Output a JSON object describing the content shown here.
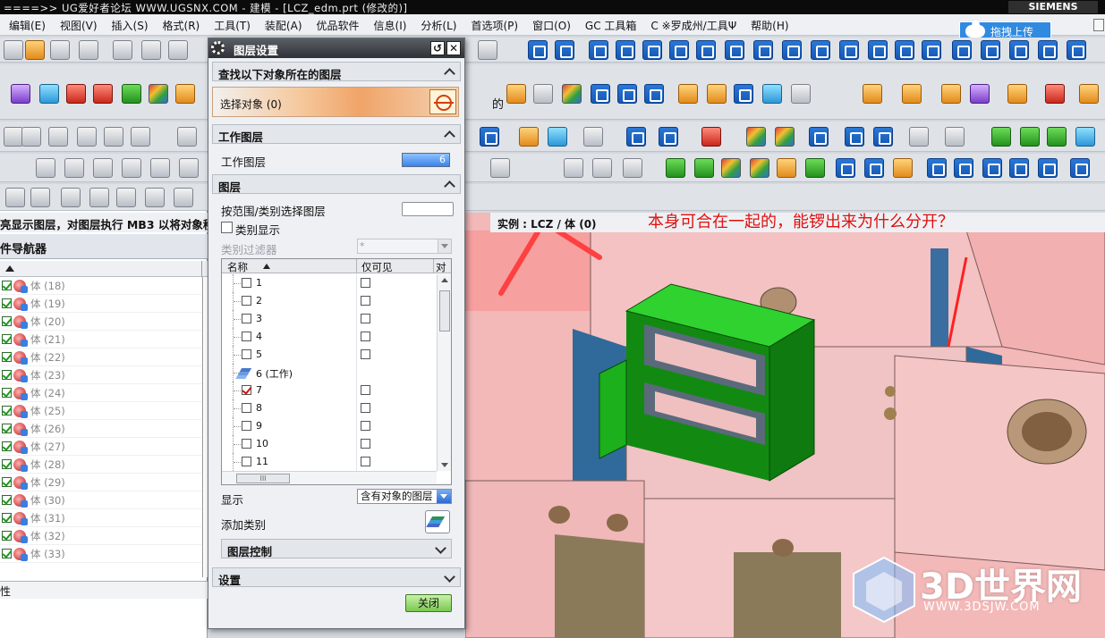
{
  "titlebar": {
    "title": "====>>  UG爱好者论坛  WWW.UGSNX.COM - 建模 - [LCZ_edm.prt (修改的)]",
    "brand": "SIEMENS"
  },
  "menu": {
    "items": [
      "编辑(E)",
      "视图(V)",
      "插入(S)",
      "格式(R)",
      "工具(T)",
      "装配(A)",
      "优品软件",
      "信息(I)",
      "分析(L)",
      "首选项(P)",
      "窗口(O)",
      "GC 工具箱",
      "C ※罗成州/工具Ψ",
      "帮助(H)"
    ]
  },
  "upload_button": "拖拽上传",
  "toolbar_text": {
    "fragment_de": "的"
  },
  "hint_text": "亮显示图层，对图层执行 MB3 以将对象移",
  "navigator": {
    "title": "件导航器",
    "rows": [
      "体 (18)",
      "体 (19)",
      "体 (20)",
      "体 (21)",
      "体 (22)",
      "体 (23)",
      "体 (24)",
      "体 (25)",
      "体 (26)",
      "体 (27)",
      "体 (28)",
      "体 (29)",
      "体 (30)",
      "体 (31)",
      "体 (32)",
      "体 (33)"
    ],
    "footer": "性"
  },
  "viewport": {
    "instance_label": "实例 : LCZ / 体 (0)",
    "annotation": "本身可合在一起的，能锣出来为什么分开？",
    "watermark_name": "3D世界网",
    "watermark_url": "WWW.3DSJW.COM"
  },
  "dialog": {
    "title": "图层设置",
    "sec_find": "查找以下对象所在的图层",
    "select_object": "选择对象 (0)",
    "sec_work": "工作图层",
    "work_layer_label": "工作图层",
    "work_layer_value": "6",
    "sec_layers": "图层",
    "range_label": "按范围/类别选择图层",
    "category_display": "类别显示",
    "category_filter": "类别过滤器",
    "filter_value": "*",
    "table_headers": {
      "name": "名称",
      "visible_only": "仅可见",
      "object": "对"
    },
    "layers": [
      {
        "name": "1",
        "checked": false
      },
      {
        "name": "2",
        "checked": false
      },
      {
        "name": "3",
        "checked": false
      },
      {
        "name": "4",
        "checked": false
      },
      {
        "name": "5",
        "checked": false
      },
      {
        "name": "6 (工作)",
        "work": true
      },
      {
        "name": "7",
        "checked": true
      },
      {
        "name": "8",
        "checked": false
      },
      {
        "name": "9",
        "checked": false
      },
      {
        "name": "10",
        "checked": false
      },
      {
        "name": "11",
        "checked": false
      }
    ],
    "hscroll_thumb": "III",
    "display_label": "显示",
    "display_value": "含有对象的图层",
    "add_category": "添加类别",
    "sec_layer_control": "图层控制",
    "sec_settings": "设置",
    "close": "关闭"
  },
  "colors": {
    "viewport_bg": "#f3b8b8",
    "green_part": "#1fb81f",
    "annotation": "#e01010"
  }
}
